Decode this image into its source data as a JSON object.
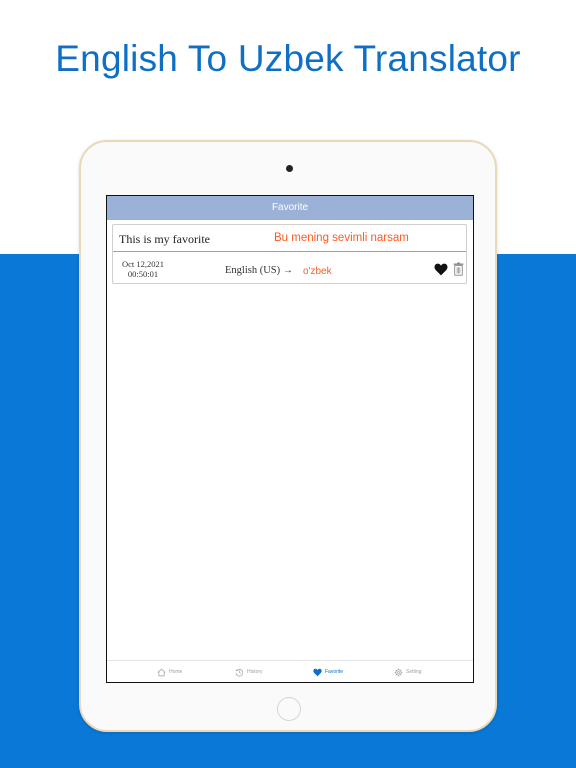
{
  "page": {
    "headline": "English To Uzbek Translator"
  },
  "screen": {
    "nav_title": "Favorite",
    "favorite": {
      "source_text": "This is my favorite",
      "translated_text": "Bu mening sevimli narsam",
      "date": "Oct 12,2021",
      "time": "00:50:01",
      "source_language": "English (US)",
      "arrow": "→",
      "target_language": "o'zbek"
    },
    "tabbar": {
      "home": "Home",
      "history": "History",
      "favorite": "Favorite",
      "setting": "Setting"
    }
  },
  "colors": {
    "brand_blue": "#0a78d7",
    "headline_blue": "#0f6fc4",
    "nav_bar": "#9bb1d8",
    "translation_orange": "#ff5a1f",
    "active_tab": "#0a6fcf"
  },
  "icons": [
    "home-icon",
    "history-icon",
    "heart-icon",
    "gear-icon",
    "trash-icon"
  ]
}
